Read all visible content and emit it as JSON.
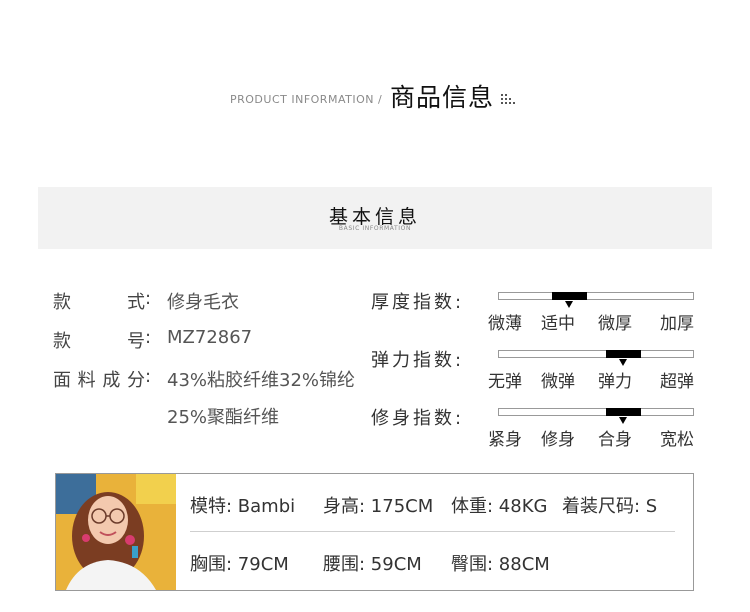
{
  "header": {
    "subtitle_en": "PRODUCT INFORMATION /",
    "title_zh": "商品信息"
  },
  "basic_info": {
    "title_zh": "基本信息",
    "title_en": "BASIC INFORMATION"
  },
  "attributes": [
    {
      "label_chars": [
        "款",
        "式"
      ],
      "colon": ":",
      "value": "修身毛衣"
    },
    {
      "label_chars": [
        "款",
        "号"
      ],
      "colon": ":",
      "value": "MZ72867"
    },
    {
      "label_chars": [
        "面",
        "料",
        "成",
        "分"
      ],
      "colon": ":",
      "value": "43%粘胶纤维32%锦纶",
      "value_line2": "25%聚酯纤维"
    }
  ],
  "indexes": [
    {
      "label": "厚度指数:",
      "ticks": [
        "微薄",
        "适中",
        "微厚",
        "加厚"
      ],
      "selected": "适中"
    },
    {
      "label": "弹力指数:",
      "ticks": [
        "无弹",
        "微弹",
        "弹力",
        "超弹"
      ],
      "selected": "弹力"
    },
    {
      "label": "修身指数:",
      "ticks": [
        "紧身",
        "修身",
        "合身",
        "宽松"
      ],
      "selected": "合身"
    }
  ],
  "model": {
    "name": "模特: Bambi",
    "height": "身高: 175CM",
    "weight": "体重: 48KG",
    "size": "着装尺码: S",
    "bust": "胸围: 79CM",
    "waist": "腰围: 59CM",
    "hips": "臀围: 88CM"
  },
  "colors": {
    "band_bg": "#f2f2f2",
    "bar_fill": "#000000",
    "photo_bg": "#e9b23a"
  }
}
